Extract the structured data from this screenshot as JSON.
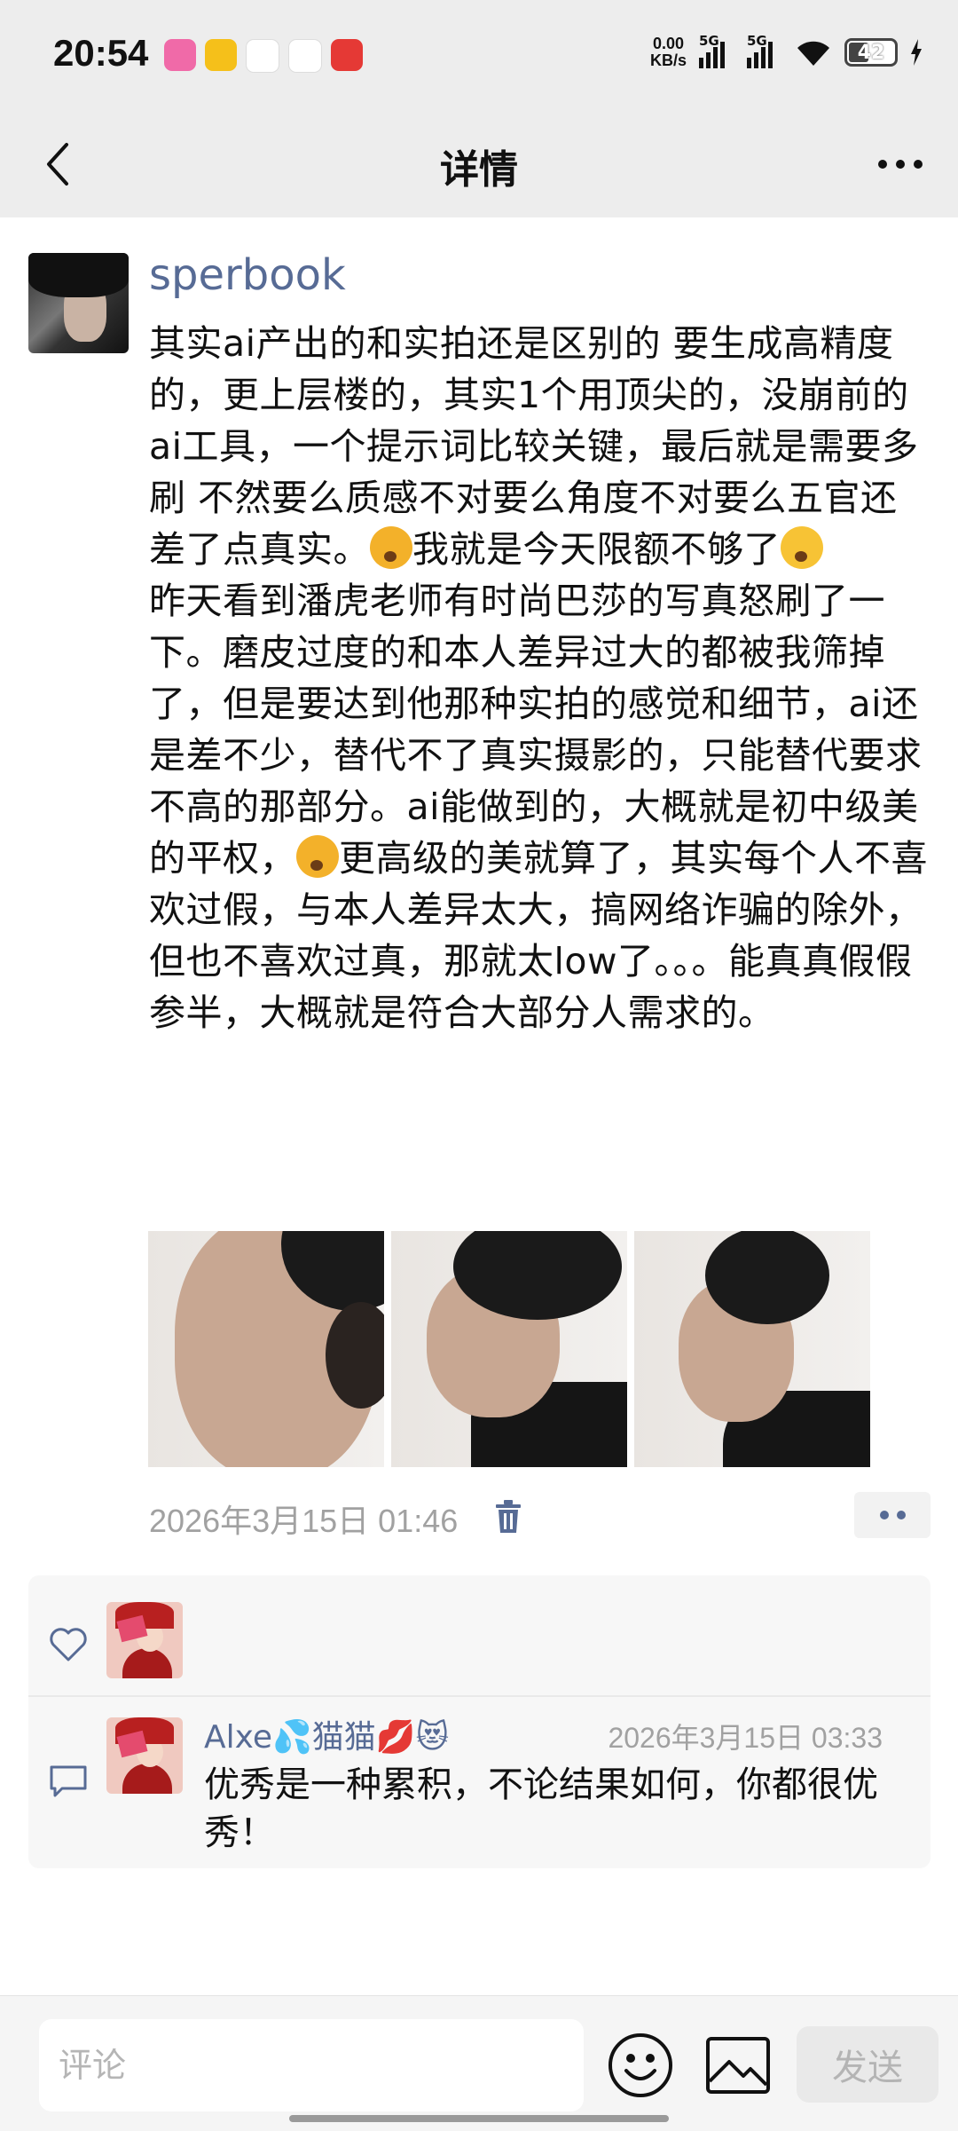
{
  "status_bar": {
    "time": "20:54",
    "net_speed_value": "0.00",
    "net_speed_unit": "KB/s",
    "signal_1": "5G",
    "signal_2": "5G",
    "battery": "42",
    "app_icons": [
      "lalalab-icon",
      "bird-app-icon",
      "baidu-icon",
      "fortune-app-icon",
      "red-stock-app-icon"
    ],
    "app_icon_colors": [
      "#f06aa8",
      "#f5c01a",
      "#ffffff",
      "#ffffff",
      "#e53935"
    ]
  },
  "header": {
    "title": "详情"
  },
  "post": {
    "author": "sperbook",
    "paragraph_1a": "其实ai产出的和实拍还是区别的 要生成高精度的，更上层楼的，其实1个用顶尖的，没崩前的ai工具，一个提示词比较关键，最后就是需要多刷 不然要么质感不对要么角度不对要么五官还差了点真实。",
    "paragraph_1b": "我就是今天限额不够了",
    "paragraph_2a": "昨天看到潘虎老师有时尚巴莎的写真怒刷了一下。磨皮过度的和本人差异过大的都被我筛掉了，但是要达到他那种实拍的感觉和细节，ai还是差不少，替代不了真实摄影的，只能替代要求不高的那部分。ai能做到的，大概就是初中级美的平权，",
    "paragraph_2b": "更高级的美就算了，其实每个人不喜欢过假，与本人差异太大，搞网络诈骗的除外，但也不喜欢过真，那就太low了。。。能真真假假参半，大概就是符合大部分人需求的。",
    "timestamp": "2026年3月15日 01:46",
    "photo_count": 3
  },
  "comments": [
    {
      "name": "Alxe💦猫猫💋😻",
      "time": "2026年3月15日 03:33",
      "text": "优秀是一种累积，不论结果如何，你都很优秀！"
    }
  ],
  "comment_bar": {
    "placeholder": "评论",
    "send_label": "发送"
  },
  "colors": {
    "link_blue": "#576b95",
    "meta_gray": "#a1a1a1",
    "header_bg": "#ededed"
  }
}
